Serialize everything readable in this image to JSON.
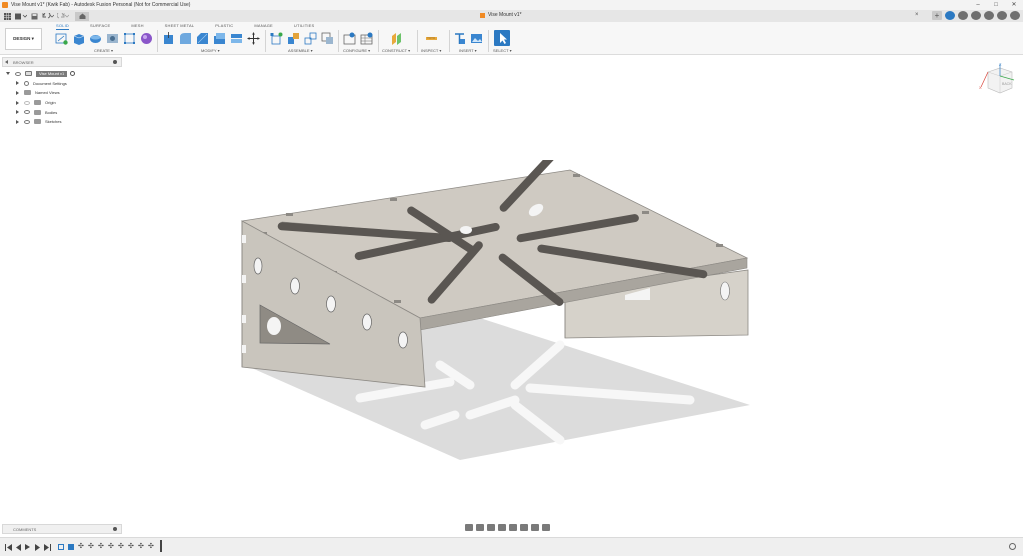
{
  "window": {
    "title": "Vise Mount v1* (Kwik Fab) - Autodesk Fusion Personal (Not for Commercial Use)",
    "minimize": "–",
    "maximize": "□",
    "close": "✕"
  },
  "document_tab": {
    "label": "Vise Mount v1*",
    "close": "×"
  },
  "workspace": {
    "label": "DESIGN ▾"
  },
  "ribbon": {
    "tabs": [
      {
        "label": "SOLID",
        "active": true
      },
      {
        "label": "SURFACE"
      },
      {
        "label": "MESH"
      },
      {
        "label": "SHEET METAL"
      },
      {
        "label": "PLASTIC"
      },
      {
        "label": "MANAGE"
      },
      {
        "label": "UTILITIES"
      }
    ],
    "groups": {
      "create": "CREATE ▾",
      "modify": "MODIFY ▾",
      "assemble": "ASSEMBLE ▾",
      "configure": "CONFIGURE ▾",
      "construct": "CONSTRUCT ▾",
      "inspect": "INSPECT ▾",
      "insert": "INSERT ▾",
      "select": "SELECT ▾"
    }
  },
  "browser": {
    "title": "BROWSER",
    "root": "Vise Mount v1",
    "items": [
      {
        "label": "Document Settings"
      },
      {
        "label": "Named Views"
      },
      {
        "label": "Origin"
      },
      {
        "label": "Bodies"
      },
      {
        "label": "Sketches"
      }
    ]
  },
  "viewcube": {
    "face_label": "BACK",
    "axis_z": "Z",
    "axis_x": "X"
  },
  "comments": {
    "title": "COMMENTS"
  },
  "colors": {
    "accent": "#2b79c2",
    "fusion_orange": "#f08a24",
    "part_gray": "#cfcac2"
  }
}
